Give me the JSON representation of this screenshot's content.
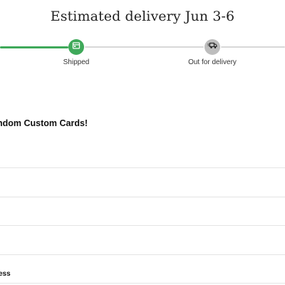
{
  "header": {
    "estimated_delivery": "Estimated delivery Jun 3-6"
  },
  "tracker": {
    "steps": [
      {
        "label": "Shipped",
        "icon": "package-icon",
        "status": "complete",
        "color": "#3fa95a"
      },
      {
        "label": "Out for delivery",
        "icon": "delivery-truck-icon",
        "status": "pending",
        "color": "#bdbdbd"
      }
    ],
    "progress_color": "#3fa95a",
    "pending_color": "#d8d8d8"
  },
  "order": {
    "heading": "ndom Custom Cards!",
    "partial_row_label": "ess"
  }
}
